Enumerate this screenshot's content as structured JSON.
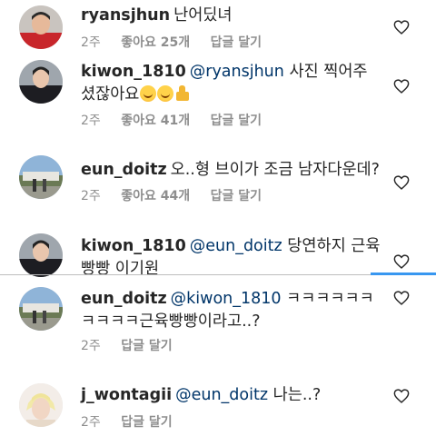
{
  "comments": [
    {
      "user": "ryansjhun",
      "mention": "",
      "text": "난어딨녀",
      "time": "2주",
      "likes": "좋아요 25개",
      "reply": "답글 달기"
    },
    {
      "user": "kiwon_1810",
      "mention": "@ryansjhun",
      "text": "사진 찍어주셨잖아요",
      "emojis": [
        "smiling-face-emoji",
        "smiling-face-emoji",
        "thumbs-up-emoji"
      ],
      "time": "2주",
      "likes": "좋아요 41개",
      "reply": "답글 달기"
    },
    {
      "user": "eun_doitz",
      "mention": "",
      "text": "오..형 브이가 조금 남자다운데?",
      "time": "2주",
      "likes": "좋아요 44개",
      "reply": "답글 달기"
    },
    {
      "user": "kiwon_1810",
      "mention": "@eun_doitz",
      "text": "당연하지 근육빵빵 이기원",
      "time": "",
      "likes": "",
      "reply": ""
    },
    {
      "user": "eun_doitz",
      "mention": "@kiwon_1810",
      "text": "ㅋㅋㅋㅋㅋㅋㅋㅋㅋㅋ근육빵빵이라고..?",
      "time": "2주",
      "likes": "",
      "reply": "답글 달기"
    },
    {
      "user": "j_wontagii",
      "mention": "@eun_doitz",
      "text": "나는..?",
      "time": "2주",
      "likes": "",
      "reply": "답글 달기"
    }
  ],
  "colors": {
    "accent": "#3897f0",
    "mention": "#003569",
    "meta": "#8e8e8e"
  },
  "icons": {
    "like": "heart-outline-icon"
  }
}
